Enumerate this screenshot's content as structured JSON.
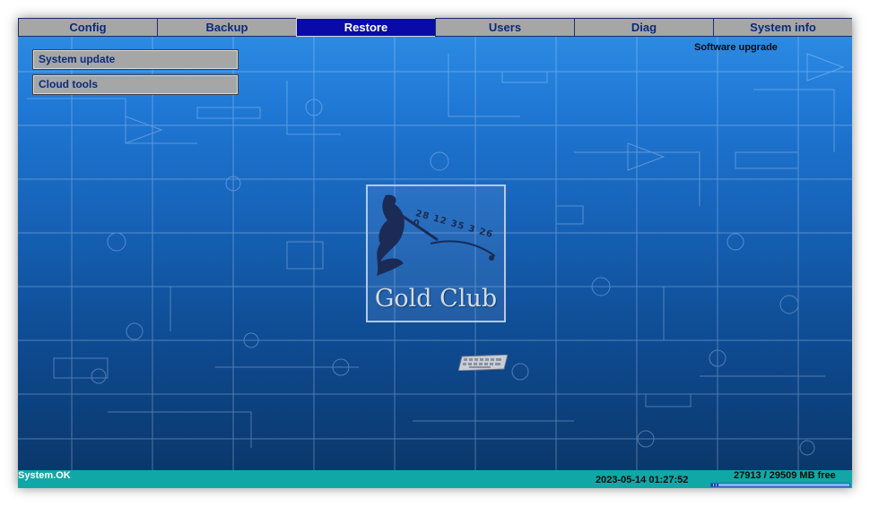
{
  "tabs": [
    {
      "label": "Config",
      "active": false
    },
    {
      "label": "Backup",
      "active": false
    },
    {
      "label": "Restore",
      "active": true
    },
    {
      "label": "Users",
      "active": false
    },
    {
      "label": "Diag",
      "active": false
    },
    {
      "label": "System info",
      "active": false
    }
  ],
  "sidebar": {
    "items": [
      {
        "label": "System update"
      },
      {
        "label": "Cloud tools"
      }
    ]
  },
  "section_title": "Software upgrade",
  "logo": {
    "text": "Gold Club",
    "digits": "28 12 35 3 26 0"
  },
  "status": {
    "text": "System.OK",
    "datetime": "2023-05-14 01:27:52",
    "disk": "27913 / 29509 MB free",
    "disk_used_fraction": 0.054
  },
  "colors": {
    "tab_bg": "#a6a6a6",
    "tab_active_bg": "#0a0aa8",
    "tab_text": "#0b2a7a",
    "statusbar_bg": "#10a8a6"
  },
  "icons": {
    "background": "circuit-schematic-background",
    "logo": "gold-club-logo",
    "keyboard": "keyboard-icon"
  }
}
